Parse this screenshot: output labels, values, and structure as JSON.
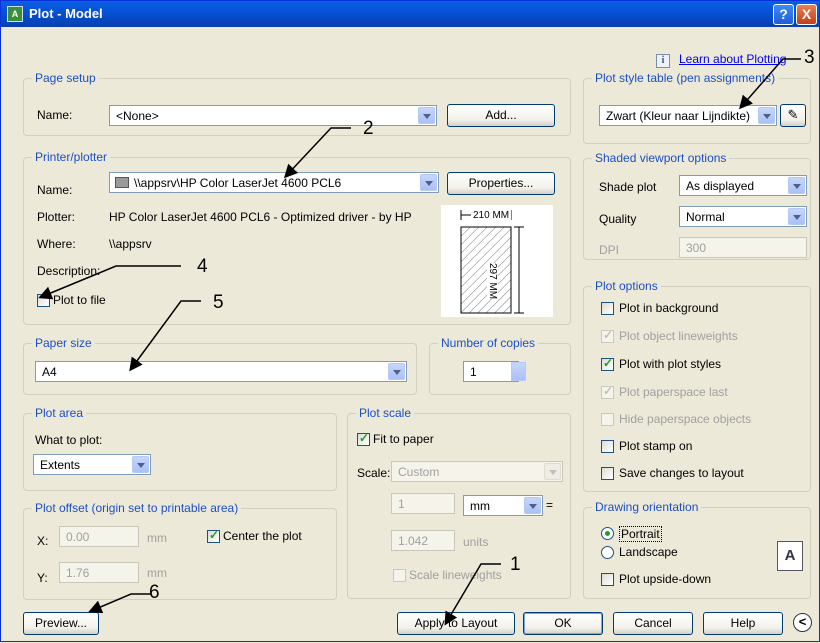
{
  "window": {
    "title": "Plot - Model",
    "help_glyph": "?",
    "close_glyph": "X"
  },
  "learn_link": "Learn about Plotting",
  "info_glyph": "i",
  "page_setup": {
    "title": "Page setup",
    "name_label": "Name:",
    "name_value": "<None>",
    "add_button": "Add..."
  },
  "printer": {
    "title": "Printer/plotter",
    "name_label": "Name:",
    "name_value": "\\\\appsrv\\HP Color LaserJet 4600 PCL6",
    "properties_button": "Properties...",
    "plotter_label": "Plotter:",
    "plotter_value": "HP Color LaserJet 4600 PCL6 - Optimized driver - by HP",
    "where_label": "Where:",
    "where_value": "\\\\appsrv",
    "description_label": "Description:",
    "plot_to_file": "Plot to file",
    "preview_width": "210 MM",
    "preview_height": "297 MM"
  },
  "paper_size": {
    "title": "Paper size",
    "value": "A4"
  },
  "copies": {
    "title": "Number of copies",
    "value": "1"
  },
  "plot_area": {
    "title": "Plot area",
    "what_label": "What to plot:",
    "what_value": "Extents"
  },
  "plot_offset": {
    "title": "Plot offset (origin set to printable area)",
    "x_label": "X:",
    "x_value": "0.00",
    "x_unit": "mm",
    "y_label": "Y:",
    "y_value": "1.76",
    "y_unit": "mm",
    "center": "Center the plot"
  },
  "plot_scale": {
    "title": "Plot scale",
    "fit": "Fit to paper",
    "scale_label": "Scale:",
    "scale_value": "Custom",
    "v1": "1",
    "unit": "mm",
    "equals": "=",
    "v2": "1.042",
    "v2_unit": "units",
    "lineweights": "Scale lineweights"
  },
  "style_table": {
    "title": "Plot style table (pen assignments)",
    "value": "Zwart (Kleur naar Lijndikte)"
  },
  "shaded": {
    "title": "Shaded viewport options",
    "shade_label": "Shade plot",
    "shade_value": "As displayed",
    "quality_label": "Quality",
    "quality_value": "Normal",
    "dpi_label": "DPI",
    "dpi_value": "300"
  },
  "plot_options": {
    "title": "Plot options",
    "items": [
      "Plot in background",
      "Plot object lineweights",
      "Plot with plot styles",
      "Plot paperspace last",
      "Hide paperspace objects",
      "Plot stamp on",
      "Save changes to layout"
    ]
  },
  "orientation": {
    "title": "Drawing orientation",
    "portrait": "Portrait",
    "landscape": "Landscape",
    "upside": "Plot upside-down",
    "icon_letter": "A"
  },
  "buttons": {
    "preview": "Preview...",
    "apply": "Apply to Layout",
    "ok": "OK",
    "cancel": "Cancel",
    "help": "Help",
    "collapse": "<"
  },
  "annotations": [
    "1",
    "2",
    "3",
    "4",
    "5",
    "6"
  ]
}
